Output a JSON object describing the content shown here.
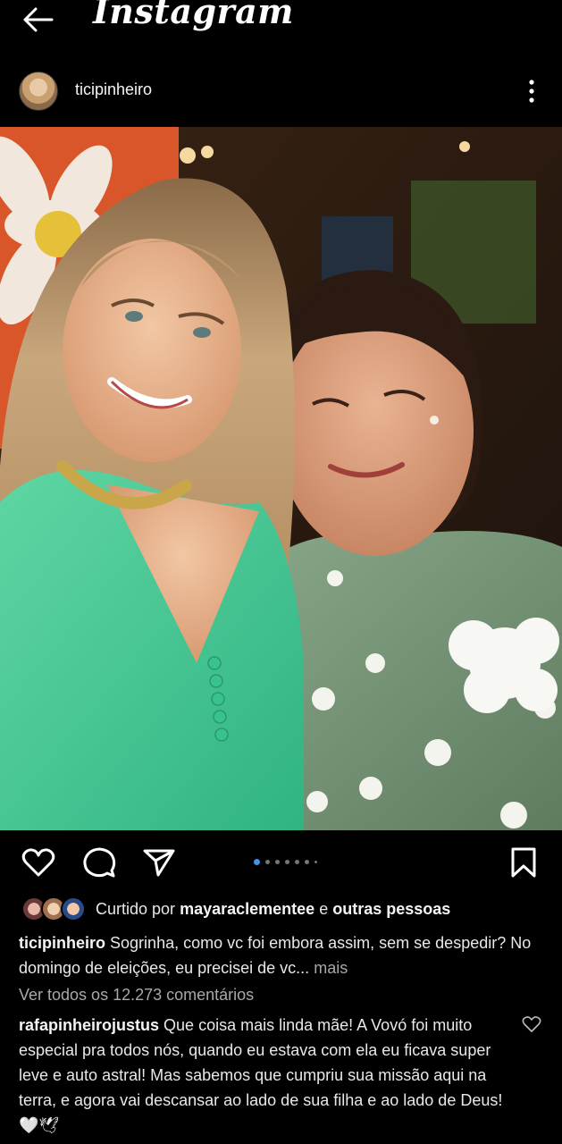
{
  "topbar": {
    "logo": "Instagram",
    "back_icon": "arrow-left-icon"
  },
  "post": {
    "username": "ticipinheiro",
    "more_icon": "more-vertical-icon",
    "photo_alt": "Selfie de duas mulheres sorrindo",
    "carousel": {
      "total": 7,
      "active": 1
    }
  },
  "actions": {
    "like_icon": "heart-icon",
    "comment_icon": "comment-icon",
    "share_icon": "send-icon",
    "save_icon": "bookmark-icon"
  },
  "likes": {
    "prefix": "Curtido por",
    "user": "mayaraclementee",
    "conjunction": "e",
    "others": "outras pessoas"
  },
  "caption": {
    "username": "ticipinheiro",
    "text": "Sogrinha, como vc foi embora assim, sem se despedir? No domingo de eleições, eu precisei de vc...",
    "more": "mais"
  },
  "view_all_comments": "Ver todos os 12.273 comentários",
  "top_comment": {
    "username": "rafapinheirojustus",
    "text": "Que coisa mais linda mãe! A Vovó foi muito especial pra todos nós, quando eu estava com ela eu ficava super leve e auto astral! Mas sabemos que cumpriu sua missão aqui na terra, e agora vai descansar ao lado de sua filha e ao lado de Deus! 🤍🕊"
  },
  "colors": {
    "background": "#000000",
    "text": "#f5f5f5",
    "muted": "#a8a8a8",
    "accent": "#3897f0"
  }
}
